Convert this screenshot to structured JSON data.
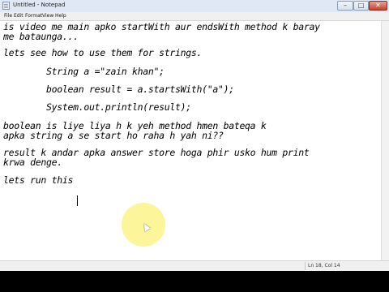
{
  "window": {
    "title": "Untitled - Notepad"
  },
  "menu": [
    "File",
    "Edit",
    "Format",
    "View",
    "Help"
  ],
  "editor": {
    "lines": [
      "is video me main apko startWith aur endsWith method k baray",
      "me bataunga...",
      "lets see how to use them for strings.",
      "        String a =\"zain khan\";",
      "        boolean result = a.startsWith(\"a\");",
      "        System.out.println(result);",
      "boolean is liye liya h k yeh method hmen bateqa k",
      "apka string a se start ho raha h yah ni??",
      "result k andar apka answer store hoga phir usko hum print",
      "krwa denge.",
      "lets run this"
    ]
  },
  "status": {
    "position": "Ln 18, Col 14"
  },
  "icons": {
    "app": "notepad-icon",
    "minimize": "minimize-icon",
    "maximize": "maximize-icon",
    "close": "close-icon"
  },
  "colors": {
    "highlight": "#fdf59a",
    "close_button": "#c2432d",
    "titlebar": "#dfe8f4"
  }
}
